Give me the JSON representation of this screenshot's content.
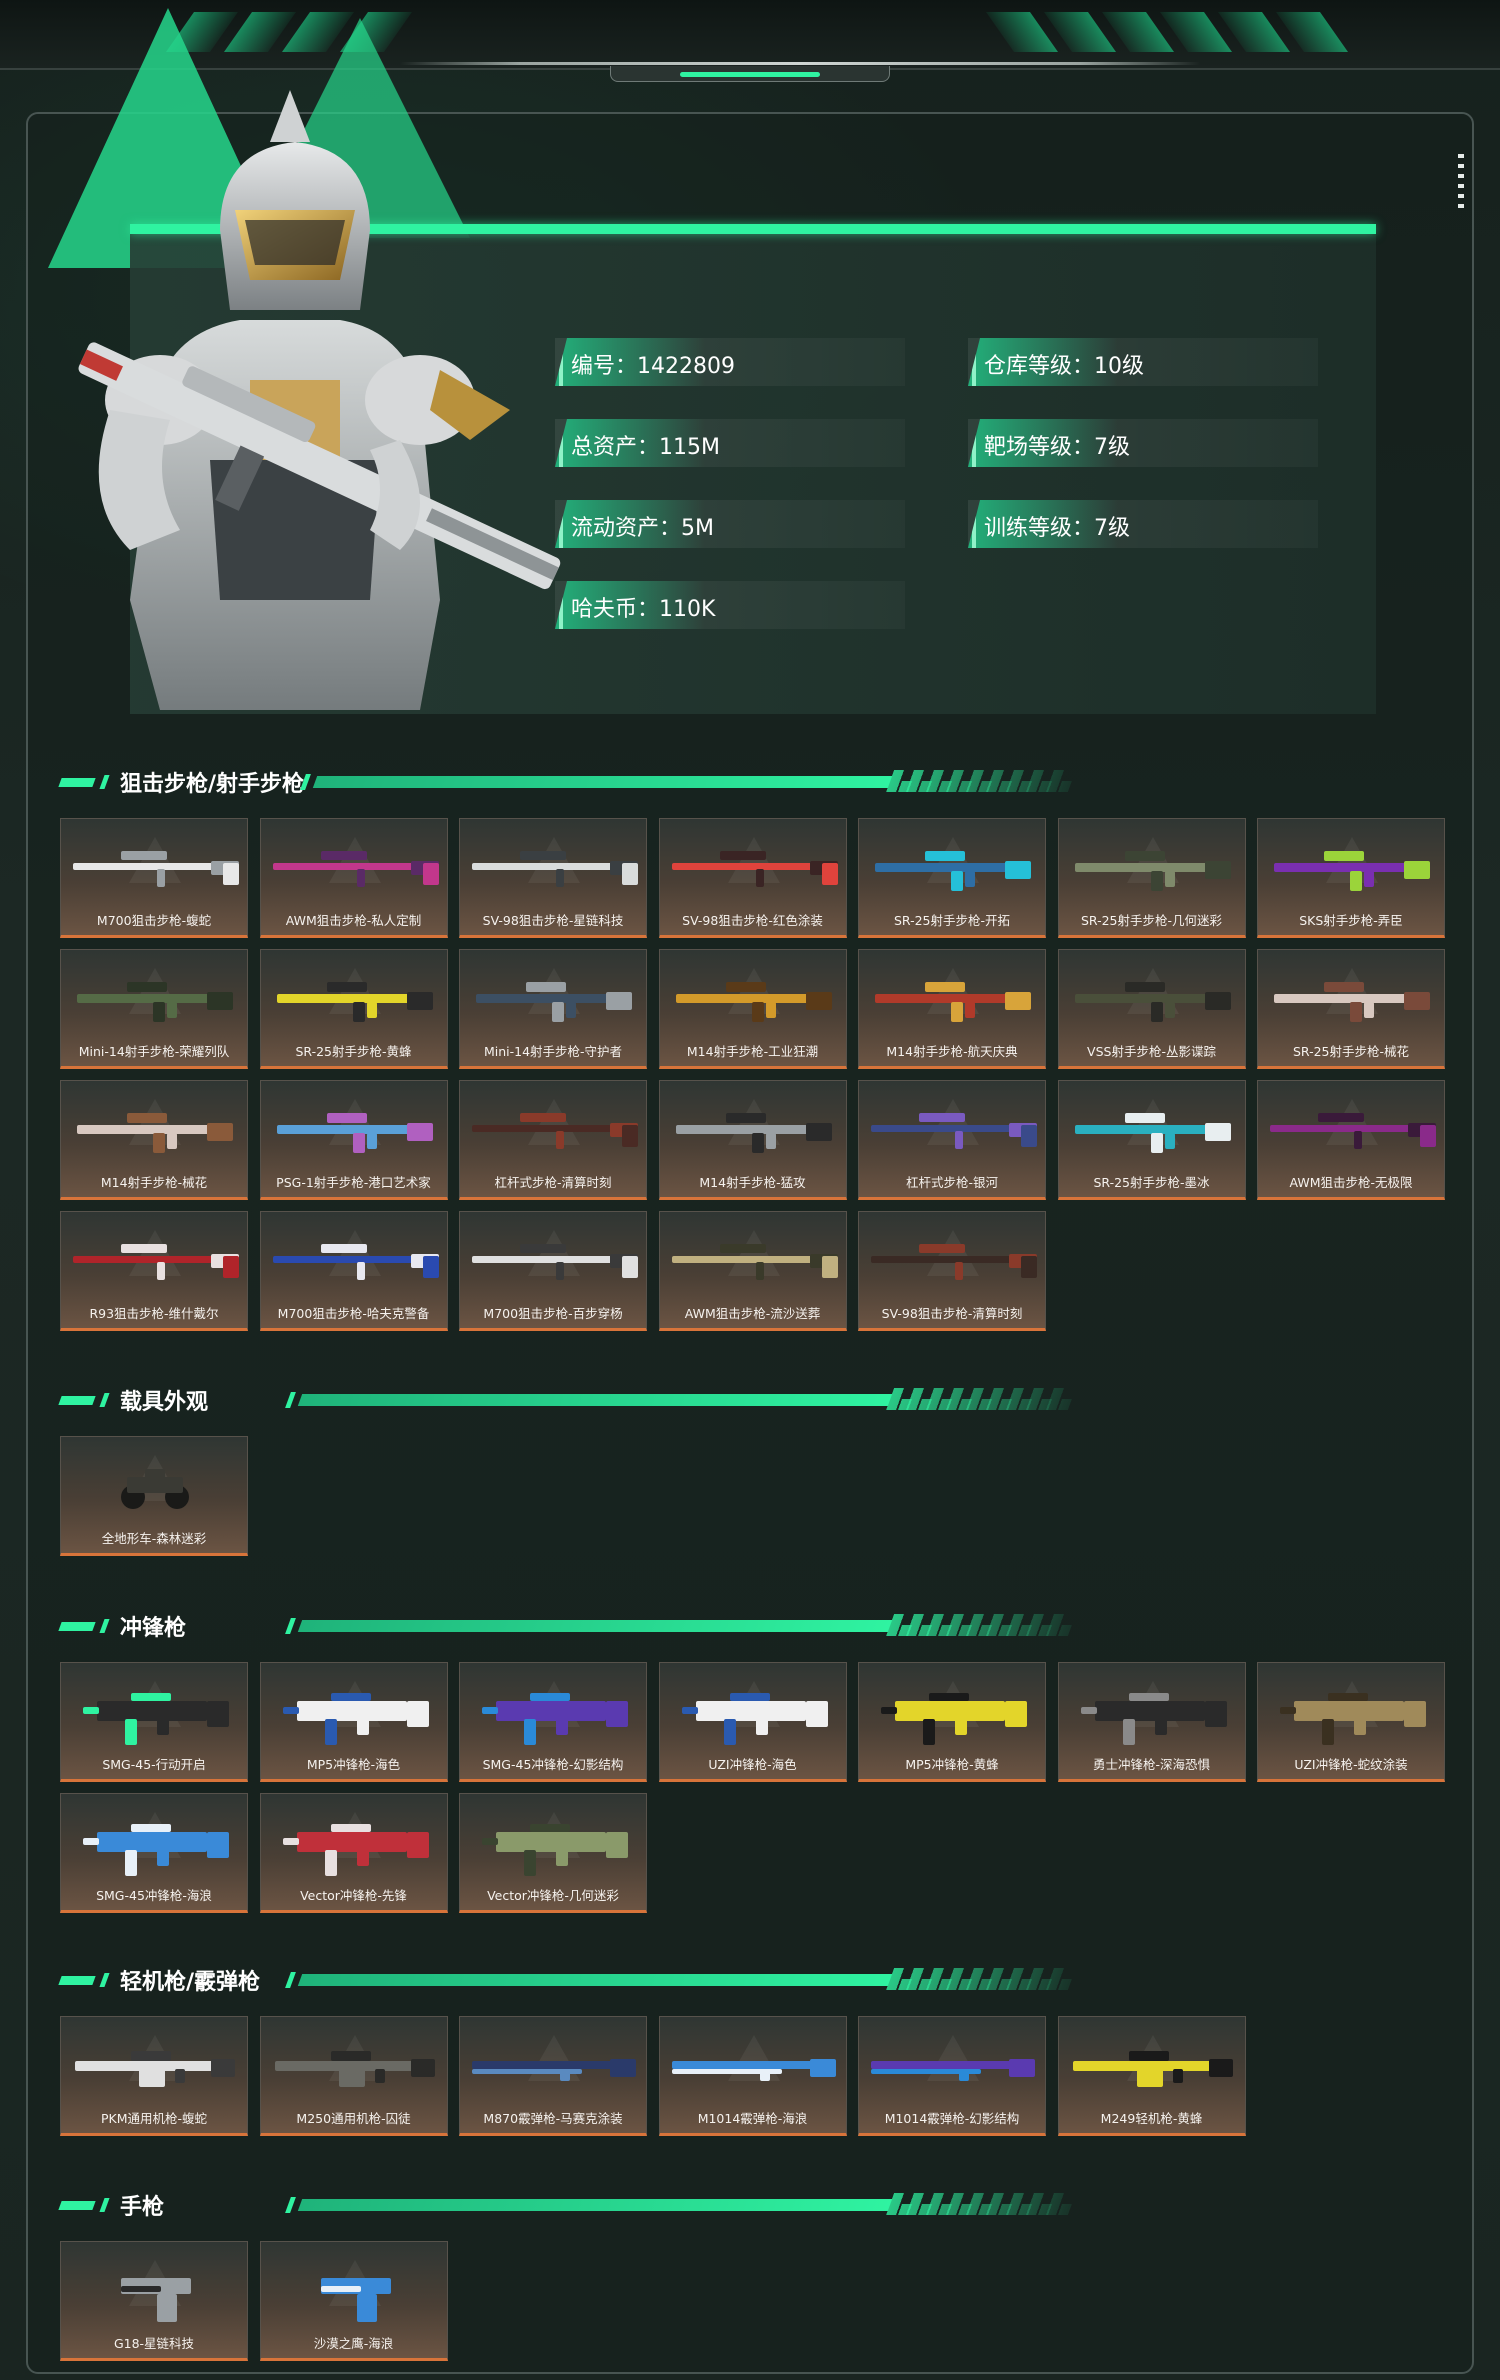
{
  "profile": {
    "left": [
      {
        "label": "编号：1422809"
      },
      {
        "label": "总资产：115M"
      },
      {
        "label": "流动资产：5M"
      },
      {
        "label": "哈夫币：110K"
      }
    ],
    "right": [
      {
        "label": "仓库等级：10级"
      },
      {
        "label": "靶场等级：7级"
      },
      {
        "label": "训练等级：7级"
      }
    ]
  },
  "colors": {
    "accent": "#2ff3a1",
    "card_border": "#d8743a"
  },
  "sections": [
    {
      "title": "狙击步枪/射手步枪",
      "items": [
        {
          "label": "M700狙击步枪-蝮蛇",
          "color": "#e8e8e8",
          "accent": "#9aa0a4",
          "kind": "sniper"
        },
        {
          "label": "AWM狙击步枪-私人定制",
          "color": "#c2378c",
          "accent": "#5a2a66",
          "kind": "sniper"
        },
        {
          "label": "SV-98狙击步枪-星链科技",
          "color": "#d9dcdc",
          "accent": "#3a3f42",
          "kind": "sniper"
        },
        {
          "label": "SV-98狙击步枪-红色涂装",
          "color": "#e0433c",
          "accent": "#3a2424",
          "kind": "sniper"
        },
        {
          "label": "SR-25射手步枪-开拓",
          "color": "#2e6ea5",
          "accent": "#25c0d8",
          "kind": "dmr"
        },
        {
          "label": "SR-25射手步枪-几何迷彩",
          "color": "#7f8a6b",
          "accent": "#3c4434",
          "kind": "dmr"
        },
        {
          "label": "SKS射手步枪-弄臣",
          "color": "#7a2fb0",
          "accent": "#9bd43a",
          "kind": "dmr"
        },
        {
          "label": "Mini-14射手步枪-荣耀列队",
          "color": "#556b46",
          "accent": "#2c3526",
          "kind": "dmr"
        },
        {
          "label": "SR-25射手步枪-黄蜂",
          "color": "#e3d52a",
          "accent": "#2a2a2a",
          "kind": "dmr"
        },
        {
          "label": "Mini-14射手步枪-守护者",
          "color": "#3c4f63",
          "accent": "#9aa0a4",
          "kind": "dmr"
        },
        {
          "label": "M14射手步枪-工业狂潮",
          "color": "#d39a2a",
          "accent": "#5a3a18",
          "kind": "dmr"
        },
        {
          "label": "M14射手步枪-航天庆典",
          "color": "#b13a2a",
          "accent": "#d8a43a",
          "kind": "dmr"
        },
        {
          "label": "VSS射手步枪-丛影谍踪",
          "color": "#4a4f3a",
          "accent": "#2a2a26",
          "kind": "dmr"
        },
        {
          "label": "SR-25射手步枪-械花",
          "color": "#d8c8c0",
          "accent": "#7a4a3a",
          "kind": "dmr"
        },
        {
          "label": "M14射手步枪-械花",
          "color": "#d8c8c0",
          "accent": "#8a5a3a",
          "kind": "dmr"
        },
        {
          "label": "PSG-1射手步枪-港口艺术家",
          "color": "#5aa0d8",
          "accent": "#b060c0",
          "kind": "dmr"
        },
        {
          "label": "杠杆式步枪-清算时刻",
          "color": "#4a2a24",
          "accent": "#8a3a2a",
          "kind": "sniper"
        },
        {
          "label": "M14射手步枪-猛攻",
          "color": "#9aa0a4",
          "accent": "#2a2a2a",
          "kind": "dmr"
        },
        {
          "label": "杠杆式步枪-银河",
          "color": "#3a4a8a",
          "accent": "#7a5ac0",
          "kind": "sniper"
        },
        {
          "label": "SR-25射手步枪-墨冰",
          "color": "#2ab0c0",
          "accent": "#e8eef0",
          "kind": "dmr"
        },
        {
          "label": "AWM狙击步枪-无极限",
          "color": "#8a2a8a",
          "accent": "#3a1a3a",
          "kind": "sniper"
        },
        {
          "label": "R93狙击步枪-维什戴尔",
          "color": "#b0242a",
          "accent": "#e8e0e0",
          "kind": "sniper"
        },
        {
          "label": "M700狙击步枪-哈夫克警备",
          "color": "#2a4ab0",
          "accent": "#e8e8f0",
          "kind": "sniper"
        },
        {
          "label": "M700狙击步枪-百步穿杨",
          "color": "#e0e0e0",
          "accent": "#3a3a3a",
          "kind": "sniper"
        },
        {
          "label": "AWM狙击步枪-流沙送葬",
          "color": "#c0b080",
          "accent": "#3a3a2a",
          "kind": "sniper"
        },
        {
          "label": "SV-98狙击步枪-清算时刻",
          "color": "#3a2a24",
          "accent": "#8a3a2a",
          "kind": "sniper"
        }
      ]
    },
    {
      "title": "载具外观",
      "items": [
        {
          "label": "全地形车-森林迷彩",
          "color": "#3a3a34",
          "accent": "#1a1a18",
          "kind": "atv"
        }
      ]
    },
    {
      "title": "冲锋枪",
      "items": [
        {
          "label": "SMG-45-行动开启",
          "color": "#2a2a2a",
          "accent": "#2ff3a1",
          "kind": "smg"
        },
        {
          "label": "MP5冲锋枪-海色",
          "color": "#f0f0f0",
          "accent": "#2a5ab0",
          "kind": "smg"
        },
        {
          "label": "SMG-45冲锋枪-幻影结构",
          "color": "#5a3ab0",
          "accent": "#2a8ad8",
          "kind": "smg"
        },
        {
          "label": "UZI冲锋枪-海色",
          "color": "#f0f0f0",
          "accent": "#2a5ab0",
          "kind": "smg"
        },
        {
          "label": "MP5冲锋枪-黄蜂",
          "color": "#e3d52a",
          "accent": "#1a1a1a",
          "kind": "smg"
        },
        {
          "label": "勇士冲锋枪-深海恐惧",
          "color": "#2a2a2a",
          "accent": "#8a8a8a",
          "kind": "smg"
        },
        {
          "label": "UZI冲锋枪-蛇纹涂装",
          "color": "#a08a5a",
          "accent": "#3a3020",
          "kind": "smg"
        },
        {
          "label": "SMG-45冲锋枪-海浪",
          "color": "#3a8ad8",
          "accent": "#e8f0f8",
          "kind": "smg"
        },
        {
          "label": "Vector冲锋枪-先锋",
          "color": "#c0303a",
          "accent": "#e8e0e0",
          "kind": "smg"
        },
        {
          "label": "Vector冲锋枪-几何迷彩",
          "color": "#8a9a6a",
          "accent": "#3a4430",
          "kind": "smg"
        }
      ]
    },
    {
      "title": "轻机枪/霰弹枪",
      "items": [
        {
          "label": "PKM通用机枪-蝮蛇",
          "color": "#e0e0e0",
          "accent": "#3a3a3a",
          "kind": "lmg"
        },
        {
          "label": "M250通用机枪-囚徒",
          "color": "#6a6a64",
          "accent": "#2a2a28",
          "kind": "lmg"
        },
        {
          "label": "M870霰弹枪-马赛克涂装",
          "color": "#2a3a6a",
          "accent": "#5a8ac0",
          "kind": "shotgun"
        },
        {
          "label": "M1014霰弹枪-海浪",
          "color": "#3a8ad8",
          "accent": "#e8f0f8",
          "kind": "shotgun"
        },
        {
          "label": "M1014霰弹枪-幻影结构",
          "color": "#5a3ab0",
          "accent": "#2a8ad8",
          "kind": "shotgun"
        },
        {
          "label": "M249轻机枪-黄蜂",
          "color": "#e3d52a",
          "accent": "#1a1a1a",
          "kind": "lmg"
        }
      ]
    },
    {
      "title": "手枪",
      "items": [
        {
          "label": "G18-星链科技",
          "color": "#9aa0a4",
          "accent": "#2a2a2a",
          "kind": "pistol"
        },
        {
          "label": "沙漠之鹰-海浪",
          "color": "#3a8ad8",
          "accent": "#e8f0f8",
          "kind": "pistol"
        }
      ]
    }
  ]
}
